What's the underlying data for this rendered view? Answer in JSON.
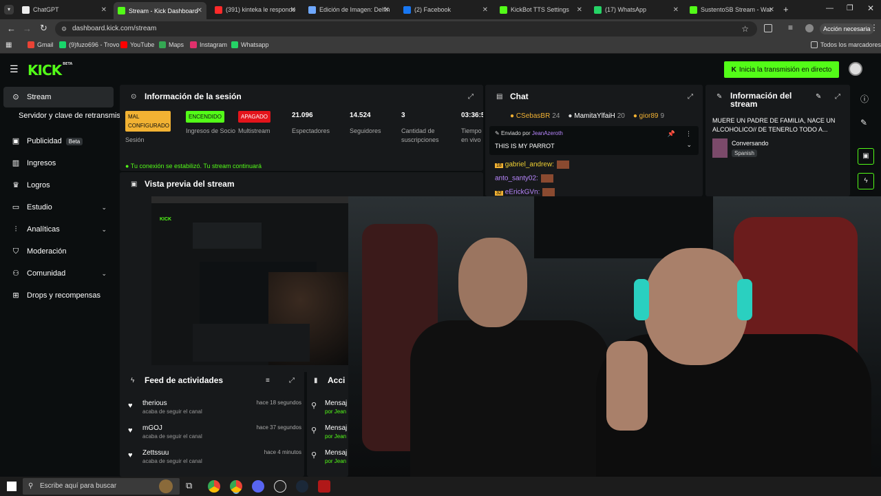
{
  "browser": {
    "tabs": [
      {
        "label": "ChatGPT",
        "color": "#ececec"
      },
      {
        "label": "Stream - Kick Dashboard",
        "color": "#53fc18",
        "active": true
      },
      {
        "label": "(391) kinteka le responde",
        "color": "#ff2a2a"
      },
      {
        "label": "Edición de Imagen: Delfin",
        "color": "#6fa8ff"
      },
      {
        "label": "(2) Facebook",
        "color": "#1877f2"
      },
      {
        "label": "KickBot TTS Settings",
        "color": "#53fc18"
      },
      {
        "label": "(17) WhatsApp",
        "color": "#25d366"
      },
      {
        "label": "SustentoSB Stream - Wat",
        "color": "#53fc18"
      }
    ],
    "url": "dashboard.kick.com/stream",
    "action_label": "Acción necesaria",
    "bookmarks": [
      {
        "label": "Gmail",
        "color": "#ea4335"
      },
      {
        "label": "(9)fuzo696 - Trovo",
        "color": "#19d66b"
      },
      {
        "label": "YouTube",
        "color": "#ff0000"
      },
      {
        "label": "Maps",
        "color": "#34a853"
      },
      {
        "label": "Instagram",
        "color": "#e1306c"
      },
      {
        "label": "Whatsapp",
        "color": "#25d366"
      }
    ],
    "all_bookmarks": "Todos los marcadores"
  },
  "kick": {
    "logo": "KICK",
    "logo_beta": "BETA",
    "go_live": "Inicia la transmisión en directo",
    "sidebar": [
      {
        "label": "Stream",
        "icon": "radio",
        "selected": true
      },
      {
        "label": "Servidor y clave de retransmisión",
        "icon": ""
      },
      {
        "label": "Publicidad",
        "icon": "ad",
        "badge": "Beta"
      },
      {
        "label": "Ingresos",
        "icon": "chart"
      },
      {
        "label": "Logros",
        "icon": "trophy"
      },
      {
        "label": "Estudio",
        "icon": "tv",
        "chevron": true
      },
      {
        "label": "Analíticas",
        "icon": "stats",
        "chevron": true
      },
      {
        "label": "Moderación",
        "icon": "shield"
      },
      {
        "label": "Comunidad",
        "icon": "users",
        "chevron": true
      },
      {
        "label": "Drops y recompensas",
        "icon": "gift"
      }
    ],
    "session": {
      "title": "Información de la sesión",
      "stats": [
        {
          "pill": "MAL CONFIGURADO",
          "pill_color": "#f2b233",
          "label": "Sesión"
        },
        {
          "pill": "ENCENDIDO",
          "pill_color": "#53fc18",
          "label": "Ingresos de Socio"
        },
        {
          "pill": "APAGADO",
          "pill_color": "#e4141b",
          "label": "Multistream"
        },
        {
          "value": "21.096",
          "label": "Espectadores"
        },
        {
          "value": "14.524",
          "label": "Seguidores"
        },
        {
          "value": "3",
          "label": "Cantidad de suscripciones"
        },
        {
          "value": "03:36:5",
          "label": "Tiempo en vivo"
        }
      ],
      "notice": "Tu conexión se estabilizó. Tu stream continuará"
    },
    "preview_title": "Vista previa del stream",
    "chat": {
      "title": "Chat",
      "top": [
        {
          "name": "CSebasBR",
          "count": "24"
        },
        {
          "name": "MamitaYlfaiH",
          "count": "20"
        },
        {
          "name": "gior89",
          "count": "9"
        }
      ],
      "pinned_by_label": "Enviado por",
      "pinned_by": "JeanAzeroth",
      "pinned_msg": "THIS IS MY PARROT",
      "messages": [
        {
          "badge": "18",
          "name": "gabriel_andrew:",
          "color": "#f2d233"
        },
        {
          "badge": "",
          "name": "anto_santy02:",
          "color": "#b987ff"
        },
        {
          "badge": "32",
          "name": "eErickGVn:",
          "color": "#b987ff"
        }
      ]
    },
    "stream_info": {
      "title": "Información del stream",
      "text": "MUERE UN PADRE DE FAMILIA, NACE UN ALCOHOLICO// DE TENERLO TODO A...",
      "category": "Conversando",
      "language": "Spanish"
    },
    "feed": {
      "title": "Feed de actividades",
      "items": [
        {
          "name": "therious",
          "sub": "acaba de seguir el canal",
          "time": "hace 18 segundos"
        },
        {
          "name": "mGOJ",
          "sub": "acaba de seguir el canal",
          "time": "hace 37 segundos"
        },
        {
          "name": "Zettssuu",
          "sub": "acaba de seguir el canal",
          "time": "hace 4 minutos"
        }
      ]
    },
    "actions": {
      "title": "Acci",
      "items": [
        {
          "name": "Mensaj",
          "sub": "por Jean"
        },
        {
          "name": "Mensaj",
          "sub": "por Jean"
        },
        {
          "name": "Mensaj",
          "sub": "por Jean"
        }
      ]
    }
  },
  "taskbar": {
    "search_placeholder": "Escribe aquí para buscar"
  }
}
